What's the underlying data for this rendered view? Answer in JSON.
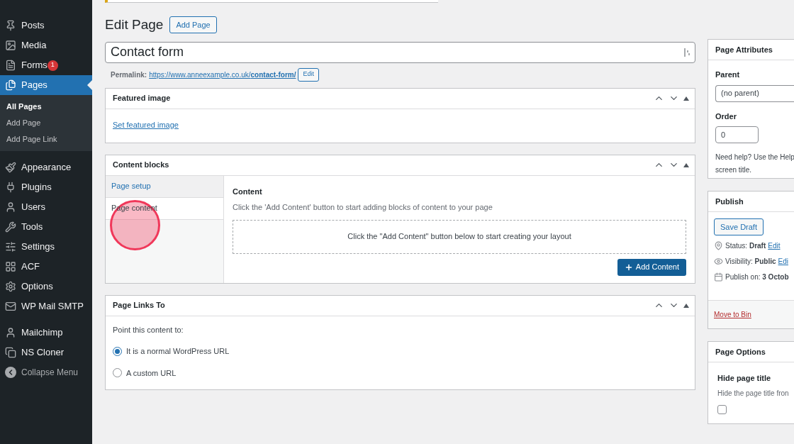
{
  "sidebar": {
    "items": [
      {
        "label": "Posts",
        "selected": false
      },
      {
        "label": "Media",
        "selected": false
      },
      {
        "label": "Forms",
        "selected": false,
        "badge": "1"
      },
      {
        "label": "Pages",
        "selected": true,
        "children": [
          {
            "label": "All Pages",
            "selected": true
          },
          {
            "label": "Add Page",
            "selected": false
          },
          {
            "label": "Add Page Link",
            "selected": false
          }
        ]
      },
      {
        "label": "Appearance",
        "selected": false
      },
      {
        "label": "Plugins",
        "selected": false
      },
      {
        "label": "Users",
        "selected": false
      },
      {
        "label": "Tools",
        "selected": false
      },
      {
        "label": "Settings",
        "selected": false
      },
      {
        "label": "ACF",
        "selected": false
      },
      {
        "label": "Options",
        "selected": false
      },
      {
        "label": "WP Mail SMTP",
        "selected": false
      },
      {
        "label": "Mailchimp",
        "selected": false
      },
      {
        "label": "NS Cloner",
        "selected": false
      },
      {
        "label": "Collapse Menu",
        "selected": false
      }
    ]
  },
  "header": {
    "title": "Edit Page",
    "button": "Add Page"
  },
  "title_field": {
    "value": "Contact form"
  },
  "permalink": {
    "label": "Permalink:",
    "url_base": "https://www.anneexample.co.uk/",
    "slug": "contact-form/",
    "button": "Edit"
  },
  "featured_image": {
    "title": "Featured image",
    "link": "Set featured image"
  },
  "content_blocks": {
    "title": "Content blocks",
    "tabs": [
      {
        "label": "Page setup",
        "selected": false
      },
      {
        "label": "Page content",
        "selected": true
      }
    ],
    "field_label": "Content",
    "description": "Click the 'Add Content' button to start adding blocks of content to your page",
    "empty_message": "Click the \"Add Content\" button below to start creating your layout",
    "button": "Add Content"
  },
  "page_links_to": {
    "title": "Page Links To",
    "prompt": "Point this content to:",
    "options": [
      {
        "label": "It is a normal WordPress URL",
        "selected": true
      },
      {
        "label": "A custom URL",
        "selected": false
      }
    ]
  },
  "page_attributes": {
    "title": "Page Attributes",
    "parent_label": "Parent",
    "parent_value": "(no parent)",
    "order_label": "Order",
    "order_value": "0",
    "help": "Need help? Use the Help",
    "help_2": "screen title."
  },
  "publish": {
    "title": "Publish",
    "save_button": "Save Draft",
    "status_label": "Status:",
    "status_value": "Draft",
    "status_edit": "Edit",
    "visibility_label": "Visibility:",
    "visibility_value": "Public",
    "visibility_edit": "Edi",
    "publish_on": "Publish on:",
    "publish_date": "3 Octob",
    "bin": "Move to Bin"
  },
  "page_options": {
    "title": "Page Options",
    "label": "Hide page title",
    "description": "Hide the page title fron",
    "checked": false
  },
  "click_highlight": {
    "visible": true
  }
}
